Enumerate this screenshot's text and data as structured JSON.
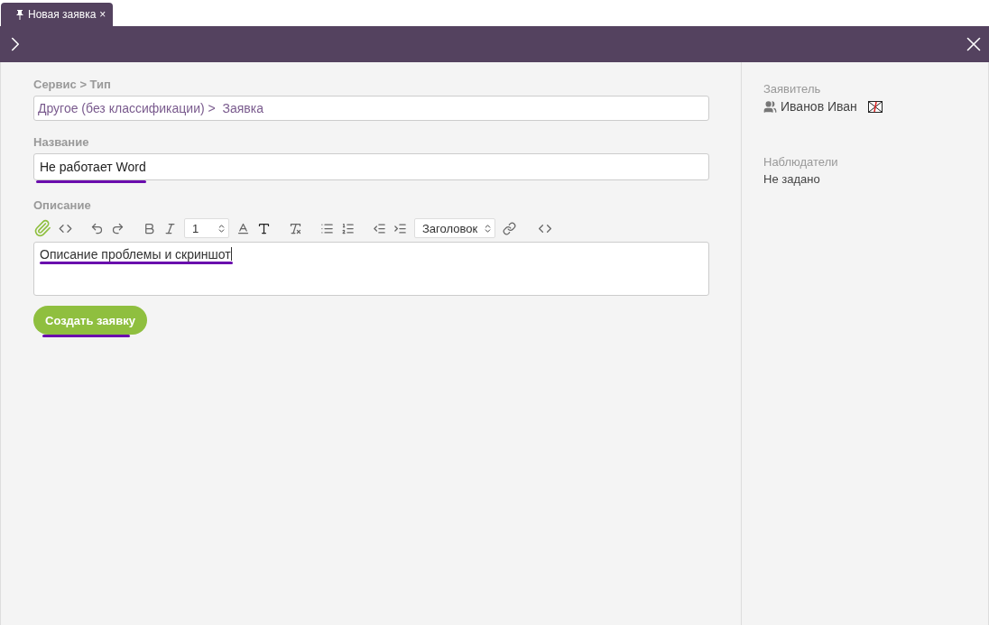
{
  "tabs": [
    {
      "label": "Новая заявка",
      "selected": true,
      "close": "×"
    }
  ],
  "form": {
    "service": {
      "label": "Сервис > Тип",
      "value": "Другое (без классификации) >  Заявка"
    },
    "title": {
      "label": "Название",
      "value": "Не работает Word",
      "underlined": true
    },
    "description": {
      "label": "Описание",
      "font_size": "1",
      "heading": "Заголовок",
      "value": "Описание проблемы и скриншот",
      "underlined": true
    },
    "submit": {
      "label": "Создать заявку",
      "underlined": true
    }
  },
  "sidebar": {
    "requester": {
      "label": "Заявитель",
      "value": "Иванов Иван"
    },
    "watchers": {
      "label": "Наблюдатели",
      "value": "Не задано"
    }
  }
}
